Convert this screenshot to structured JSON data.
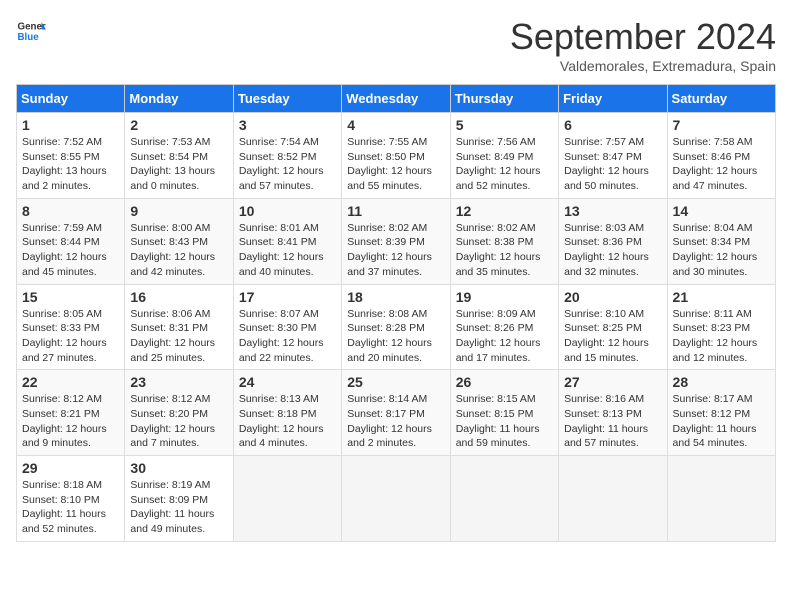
{
  "header": {
    "logo_line1": "General",
    "logo_line2": "Blue",
    "month_title": "September 2024",
    "subtitle": "Valdemorales, Extremadura, Spain"
  },
  "columns": [
    "Sunday",
    "Monday",
    "Tuesday",
    "Wednesday",
    "Thursday",
    "Friday",
    "Saturday"
  ],
  "weeks": [
    [
      {
        "day": "1",
        "info": "Sunrise: 7:52 AM\nSunset: 8:55 PM\nDaylight: 13 hours\nand 2 minutes."
      },
      {
        "day": "2",
        "info": "Sunrise: 7:53 AM\nSunset: 8:54 PM\nDaylight: 13 hours\nand 0 minutes."
      },
      {
        "day": "3",
        "info": "Sunrise: 7:54 AM\nSunset: 8:52 PM\nDaylight: 12 hours\nand 57 minutes."
      },
      {
        "day": "4",
        "info": "Sunrise: 7:55 AM\nSunset: 8:50 PM\nDaylight: 12 hours\nand 55 minutes."
      },
      {
        "day": "5",
        "info": "Sunrise: 7:56 AM\nSunset: 8:49 PM\nDaylight: 12 hours\nand 52 minutes."
      },
      {
        "day": "6",
        "info": "Sunrise: 7:57 AM\nSunset: 8:47 PM\nDaylight: 12 hours\nand 50 minutes."
      },
      {
        "day": "7",
        "info": "Sunrise: 7:58 AM\nSunset: 8:46 PM\nDaylight: 12 hours\nand 47 minutes."
      }
    ],
    [
      {
        "day": "8",
        "info": "Sunrise: 7:59 AM\nSunset: 8:44 PM\nDaylight: 12 hours\nand 45 minutes."
      },
      {
        "day": "9",
        "info": "Sunrise: 8:00 AM\nSunset: 8:43 PM\nDaylight: 12 hours\nand 42 minutes."
      },
      {
        "day": "10",
        "info": "Sunrise: 8:01 AM\nSunset: 8:41 PM\nDaylight: 12 hours\nand 40 minutes."
      },
      {
        "day": "11",
        "info": "Sunrise: 8:02 AM\nSunset: 8:39 PM\nDaylight: 12 hours\nand 37 minutes."
      },
      {
        "day": "12",
        "info": "Sunrise: 8:02 AM\nSunset: 8:38 PM\nDaylight: 12 hours\nand 35 minutes."
      },
      {
        "day": "13",
        "info": "Sunrise: 8:03 AM\nSunset: 8:36 PM\nDaylight: 12 hours\nand 32 minutes."
      },
      {
        "day": "14",
        "info": "Sunrise: 8:04 AM\nSunset: 8:34 PM\nDaylight: 12 hours\nand 30 minutes."
      }
    ],
    [
      {
        "day": "15",
        "info": "Sunrise: 8:05 AM\nSunset: 8:33 PM\nDaylight: 12 hours\nand 27 minutes."
      },
      {
        "day": "16",
        "info": "Sunrise: 8:06 AM\nSunset: 8:31 PM\nDaylight: 12 hours\nand 25 minutes."
      },
      {
        "day": "17",
        "info": "Sunrise: 8:07 AM\nSunset: 8:30 PM\nDaylight: 12 hours\nand 22 minutes."
      },
      {
        "day": "18",
        "info": "Sunrise: 8:08 AM\nSunset: 8:28 PM\nDaylight: 12 hours\nand 20 minutes."
      },
      {
        "day": "19",
        "info": "Sunrise: 8:09 AM\nSunset: 8:26 PM\nDaylight: 12 hours\nand 17 minutes."
      },
      {
        "day": "20",
        "info": "Sunrise: 8:10 AM\nSunset: 8:25 PM\nDaylight: 12 hours\nand 15 minutes."
      },
      {
        "day": "21",
        "info": "Sunrise: 8:11 AM\nSunset: 8:23 PM\nDaylight: 12 hours\nand 12 minutes."
      }
    ],
    [
      {
        "day": "22",
        "info": "Sunrise: 8:12 AM\nSunset: 8:21 PM\nDaylight: 12 hours\nand 9 minutes."
      },
      {
        "day": "23",
        "info": "Sunrise: 8:12 AM\nSunset: 8:20 PM\nDaylight: 12 hours\nand 7 minutes."
      },
      {
        "day": "24",
        "info": "Sunrise: 8:13 AM\nSunset: 8:18 PM\nDaylight: 12 hours\nand 4 minutes."
      },
      {
        "day": "25",
        "info": "Sunrise: 8:14 AM\nSunset: 8:17 PM\nDaylight: 12 hours\nand 2 minutes."
      },
      {
        "day": "26",
        "info": "Sunrise: 8:15 AM\nSunset: 8:15 PM\nDaylight: 11 hours\nand 59 minutes."
      },
      {
        "day": "27",
        "info": "Sunrise: 8:16 AM\nSunset: 8:13 PM\nDaylight: 11 hours\nand 57 minutes."
      },
      {
        "day": "28",
        "info": "Sunrise: 8:17 AM\nSunset: 8:12 PM\nDaylight: 11 hours\nand 54 minutes."
      }
    ],
    [
      {
        "day": "29",
        "info": "Sunrise: 8:18 AM\nSunset: 8:10 PM\nDaylight: 11 hours\nand 52 minutes."
      },
      {
        "day": "30",
        "info": "Sunrise: 8:19 AM\nSunset: 8:09 PM\nDaylight: 11 hours\nand 49 minutes."
      },
      {
        "day": "",
        "info": ""
      },
      {
        "day": "",
        "info": ""
      },
      {
        "day": "",
        "info": ""
      },
      {
        "day": "",
        "info": ""
      },
      {
        "day": "",
        "info": ""
      }
    ]
  ]
}
